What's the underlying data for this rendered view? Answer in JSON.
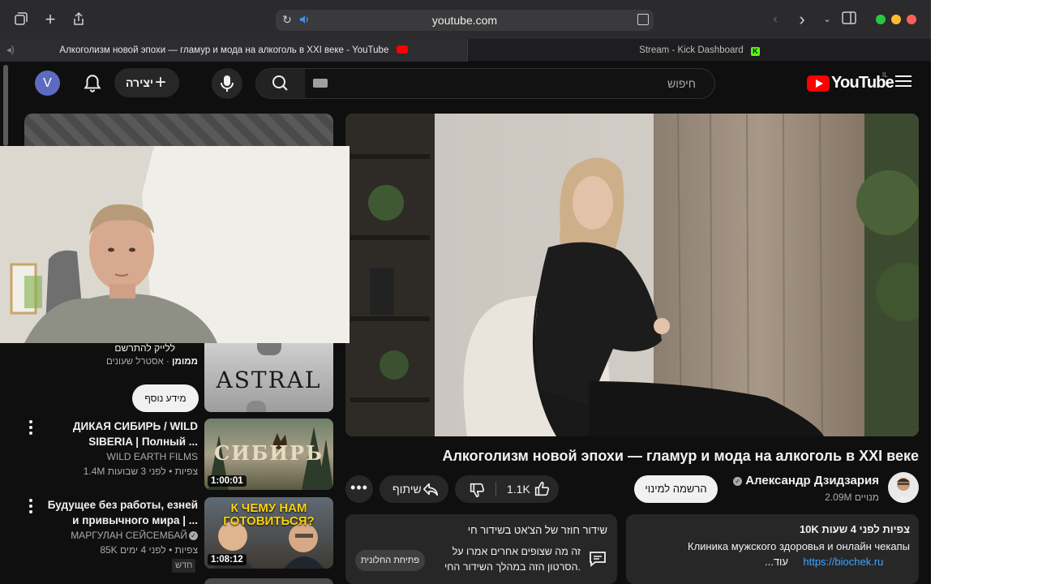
{
  "browser": {
    "url": "youtube.com",
    "tabs": [
      {
        "label": "Алкоголизм новой эпохи — гламур и мода на алкоголь в XXI веке - YouTube",
        "active": true
      },
      {
        "label": "Stream - Kick Dashboard",
        "active": false
      }
    ],
    "traffic_colors": [
      "#28c840",
      "#febc2e",
      "#ff5f57"
    ]
  },
  "header": {
    "avatar_letter": "V",
    "create_label": "יצירה",
    "search_placeholder": "חיפוש",
    "logo_text": "YouTube",
    "logo_country": "IL"
  },
  "video": {
    "title": "Алкоголизм новой эпохи — гламур и мода на алкоголь в XXI веке",
    "channel": "Александр Дзидзария",
    "subscribers": "2.09M מנויים",
    "subscribe_label": "הרשמה למינוי",
    "likes": "1.1K",
    "share_label": "שיתוף",
    "more_label": "•••"
  },
  "description": {
    "meta": "10K צפיות  לפני 4 שעות",
    "line1": "Клиника мужского здоровья  и онлайн чекапы",
    "link": "https://biochek.ru",
    "more": "...עוד"
  },
  "live_chat": {
    "title": "שידור חוזר של הצ'אט בשידור חי",
    "desc": "זה מה שצופים אחרים אמרו על הסרטון הזה במהלך השידור החי.",
    "button": "פתיחת החלונית"
  },
  "ad": {
    "subtitle": "ללייק להתרשם",
    "sponsored": "ממומן",
    "channel": "אסטרל שעונים",
    "info_button": "מידע נוסף",
    "thumb_text": "ASTRAL"
  },
  "recommendations": [
    {
      "title": "ДИКАЯ СИБИРЬ / WILD SIBERIA | Полный ...",
      "channel": "WILD EARTH FILMS",
      "meta": "1.4M צפיות • לפני 3 שבועות",
      "duration": "1:00:01",
      "thumb_text": "СИБИРЬ",
      "badge": ""
    },
    {
      "title": "Будущее без работы, езней и привычного мира | ...",
      "channel": "МАРГУЛАН СЕЙСЕМБАЙ",
      "meta": "85K צפיות • לפני 4 ימים",
      "duration": "1:08:12",
      "thumb_text": "К ЧЕМУ НАМ ГОТОВИТЬСЯ?",
      "badge": "חדש"
    }
  ]
}
